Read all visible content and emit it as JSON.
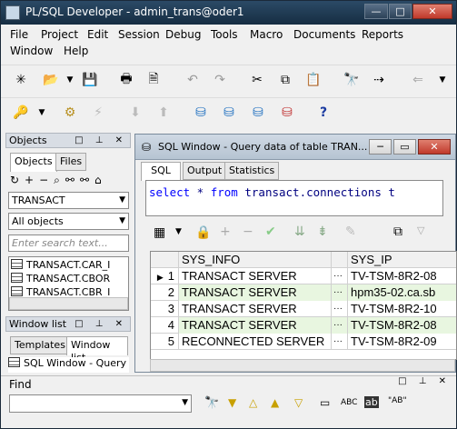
{
  "titlebar": {
    "title": "PL/SQL Developer - admin_trans@oder1",
    "minimize": "—",
    "maximize": "□",
    "close": "✕"
  },
  "menu": {
    "items": [
      "File",
      "Project",
      "Edit",
      "Session",
      "Debug",
      "Tools",
      "Macro",
      "Documents",
      "Reports",
      "Window",
      "Help"
    ]
  },
  "objects_panel": {
    "title": "Objects",
    "tabs": [
      "Objects",
      "Files"
    ],
    "schema_combo": "TRANSACT",
    "filter_combo": "All objects",
    "search_placeholder": "Enter search text...",
    "items": [
      "TRANSACT.CAR_I",
      "TRANSACT.CBOR",
      "TRANSACT.CBR_I"
    ]
  },
  "window_list_panel": {
    "title": "Window list",
    "tabs": [
      "Templates",
      "Window list"
    ],
    "items": [
      "SQL Window - Query"
    ]
  },
  "sql_window": {
    "title": "SQL Window - Query data of table TRAN...",
    "tabs": [
      "SQL",
      "Output",
      "Statistics"
    ],
    "sql": {
      "kw1": "select",
      "star": " * ",
      "kw2": "from",
      "rest": " transact.connections t"
    },
    "columns": [
      "SYS_INFO",
      "SYS_IP"
    ],
    "rows": [
      {
        "num": "1",
        "sys_info": "TRANSACT SERVER",
        "sys_ip": "TV-TSM-8R2-08"
      },
      {
        "num": "2",
        "sys_info": "TRANSACT SERVER",
        "sys_ip": "hpm35-02.ca.sb"
      },
      {
        "num": "3",
        "sys_info": "TRANSACT SERVER",
        "sys_ip": "TV-TSM-8R2-10"
      },
      {
        "num": "4",
        "sys_info": "TRANSACT SERVER",
        "sys_ip": "TV-TSM-8R2-08"
      },
      {
        "num": "5",
        "sys_info": "RECONNECTED SERVER",
        "sys_ip": "TV-TSM-8R2-09"
      }
    ],
    "ellipsis": "···"
  },
  "find_bar": {
    "title": "Find",
    "aa_label": "ABC",
    "quoted_label": "\"AB\""
  }
}
